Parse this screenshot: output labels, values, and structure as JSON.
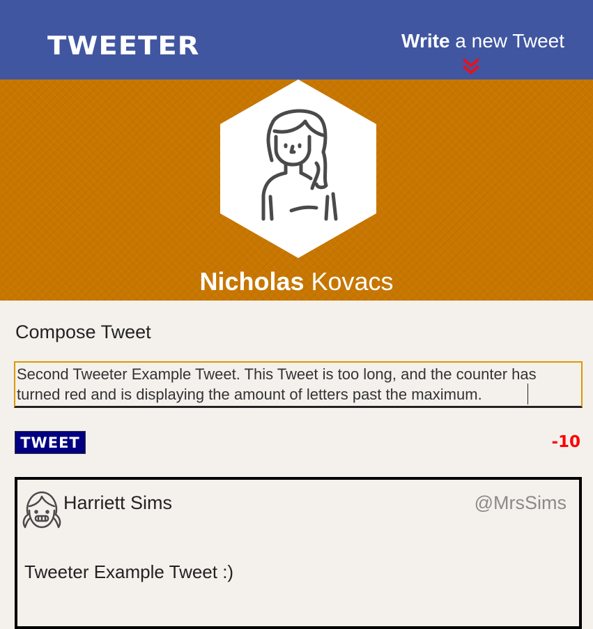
{
  "header": {
    "logo": "TWEETER",
    "write_bold": "Write",
    "write_rest": " a new Tweet",
    "chevron_icon": "double-chevron-down-icon",
    "chevron_color": "#e8101e",
    "background_color": "#4056a1"
  },
  "profile": {
    "first_name": "Nicholas",
    "last_name": " Kovacs",
    "avatar_icon": "woman-avatar-icon",
    "background_color": "#c77600"
  },
  "compose": {
    "title": "Compose Tweet",
    "text": "Second Tweeter Example Tweet. This Tweet is too long, and the counter has turned red and is displaying the amount of letters past the maximum.",
    "button_label": "TWEET",
    "counter": "-10",
    "counter_color": "#ff0000"
  },
  "tweets": [
    {
      "name": "Harriett Sims",
      "handle": "@MrsSims",
      "avatar_icon": "girl-smiling-avatar-icon",
      "text": "Tweeter Example Tweet :)"
    }
  ]
}
